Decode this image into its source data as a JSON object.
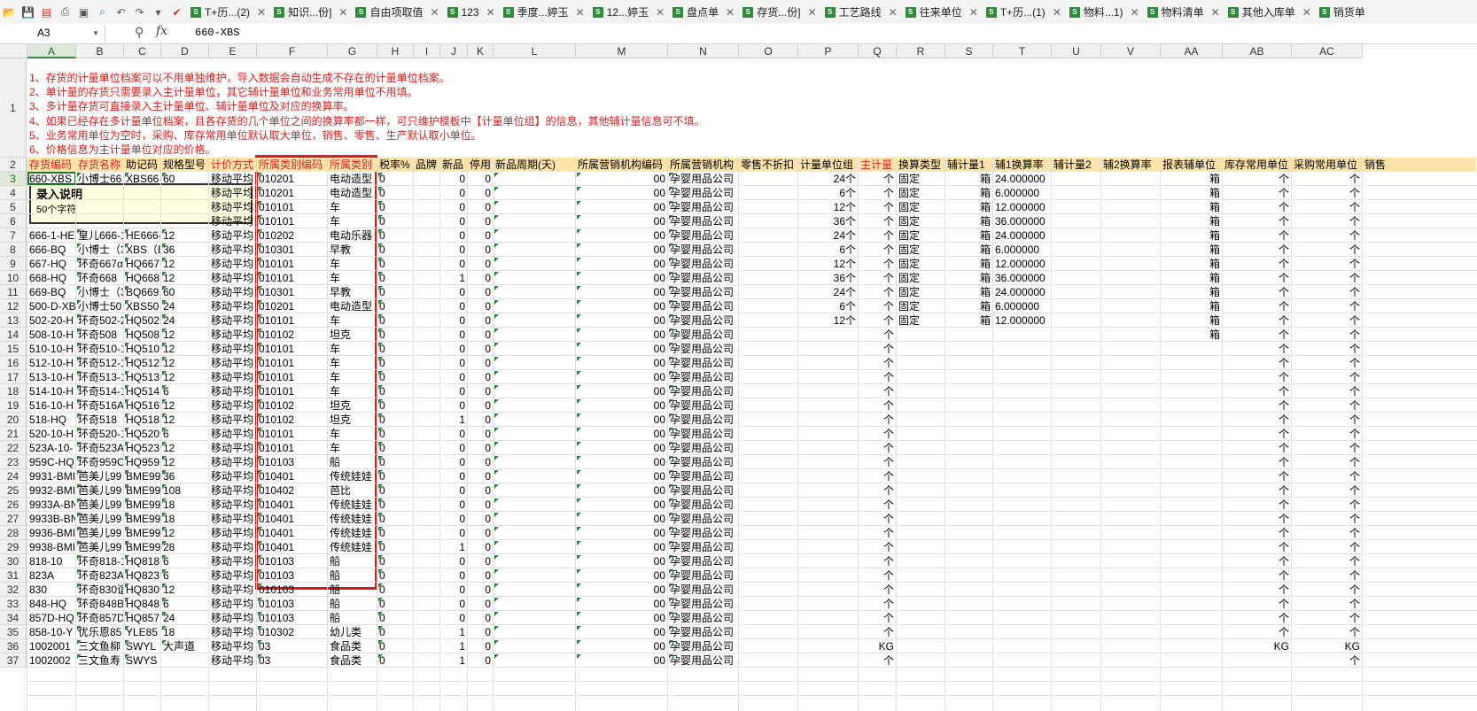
{
  "toolbar": {
    "icons": [
      "open-icon",
      "save-icon",
      "pdf-icon",
      "print-icon",
      "print-preview-icon",
      "find-icon",
      "undo-icon",
      "redo-icon",
      "dropdown-icon",
      "check-icon"
    ],
    "tabs": [
      {
        "label": "T+历...(2)",
        "closable": true
      },
      {
        "label": "知识...份]",
        "closable": true
      },
      {
        "label": "自由项取值",
        "closable": true
      },
      {
        "label": "123",
        "closable": true
      },
      {
        "label": "季度...婷玉",
        "closable": true
      },
      {
        "label": "12...婷玉",
        "closable": true
      },
      {
        "label": "盘点单",
        "closable": true
      },
      {
        "label": "存货...份]",
        "closable": true
      },
      {
        "label": "工艺路线",
        "closable": true
      },
      {
        "label": "往来单位",
        "closable": true
      },
      {
        "label": "T+历...(1)",
        "closable": true
      },
      {
        "label": "物料...1)",
        "closable": true
      },
      {
        "label": "物料清单",
        "closable": true
      },
      {
        "label": "其他入库单",
        "closable": true
      },
      {
        "label": "销货单",
        "closable": false
      }
    ]
  },
  "formula": {
    "cell_ref": "A3",
    "fx": "fx",
    "value": "660-XBS"
  },
  "columns": [
    "A",
    "B",
    "C",
    "D",
    "E",
    "F",
    "G",
    "H",
    "I",
    "J",
    "K",
    "L",
    "M",
    "N",
    "O",
    "P",
    "Q",
    "R",
    "S",
    "T",
    "U",
    "V",
    "AA",
    "AB",
    "AC"
  ],
  "notes": [
    "1、存货的计量单位档案可以不用单独维护，导入数据会自动生成不存在的计量单位档案。",
    "2、单计量的存货只需要录入主计量单位，其它辅计量单位和业务常用单位不用填。",
    "3、多计量存货可直接录入主计量单位、辅计量单位及对应的换算率。",
    "4、如果已经存在多计量单位档案，且各存货的几个单位之间的换算率都一样，可只维护模板中【计量单位组】的信息，其他辅计量信息可不填。",
    "5、业务常用单位为空时，采购、库存常用单位默认取大单位，销售、零售、生产默认取小单位。",
    "6、价格信息为主计量单位对应的价格。"
  ],
  "headers": [
    "存货编码",
    "存货名称",
    "助记码",
    "规格型号",
    "计价方式",
    "所属类别编码",
    "所属类别",
    "税率%",
    "品牌",
    "新品",
    "停用",
    "新品周期(天)",
    "所属营销机构编码",
    "所属营销机构",
    "零售不折扣",
    "计量单位组",
    "主计量",
    "换算类型",
    "辅计量1",
    "辅1换算率",
    "辅计量2",
    "辅2换算率",
    "报表辅单位",
    "库存常用单位",
    "采购常用单位",
    "销售"
  ],
  "comment": {
    "title": "录入说明",
    "body": "50个字符"
  },
  "rows": [
    {
      "n": "3",
      "a": "660-XBS",
      "b": "小博士66",
      "c": "XBS66",
      "d": "60",
      "e": "移动平均",
      "f": "010201",
      "g": "电动造型",
      "h": "0",
      "j": "0",
      "k": "0",
      "m": "00",
      "nn": "孕婴用品公司",
      "p": "24个",
      "q": "个",
      "r": "固定",
      "s": "箱",
      "t": "24.000000",
      "aa": "箱",
      "ab": "个",
      "ac": "个"
    },
    {
      "n": "4",
      "a": "",
      "b": "",
      "c": "",
      "d": "",
      "e": "移动平均",
      "f": "010201",
      "g": "电动造型",
      "h": "0",
      "j": "0",
      "k": "0",
      "m": "00",
      "nn": "孕婴用品公司",
      "p": "6个",
      "q": "个",
      "r": "固定",
      "s": "箱",
      "t": "6.000000",
      "aa": "箱",
      "ab": "个",
      "ac": "个"
    },
    {
      "n": "5",
      "a": "",
      "b": "",
      "c": "",
      "d": "",
      "e": "移动平均",
      "f": "010101",
      "g": "车",
      "h": "0",
      "j": "0",
      "k": "0",
      "m": "00",
      "nn": "孕婴用品公司",
      "p": "12个",
      "q": "个",
      "r": "固定",
      "s": "箱",
      "t": "12.000000",
      "aa": "箱",
      "ab": "个",
      "ac": "个"
    },
    {
      "n": "6",
      "a": "",
      "b": "",
      "c": "",
      "d": "",
      "e": "移动平均",
      "f": "010101",
      "g": "车",
      "h": "0",
      "j": "0",
      "k": "0",
      "m": "00",
      "nn": "孕婴用品公司",
      "p": "36个",
      "q": "个",
      "r": "固定",
      "s": "箱",
      "t": "36.000000",
      "aa": "箱",
      "ab": "个",
      "ac": "个"
    },
    {
      "n": "7",
      "a": "666-1-HE",
      "b": "皇儿666-1",
      "c": "HE666-1",
      "d": "12",
      "e": "移动平均",
      "f": "010202",
      "g": "电动乐器",
      "h": "0",
      "j": "0",
      "k": "0",
      "m": "00",
      "nn": "孕婴用品公司",
      "p": "24个",
      "q": "个",
      "r": "固定",
      "s": "箱",
      "t": "24.000000",
      "aa": "箱",
      "ab": "个",
      "ac": "个"
    },
    {
      "n": "8",
      "a": "666-BQ",
      "b": "小博士（3",
      "c": "XBS（B",
      "d": "36",
      "e": "移动平均",
      "f": "010301",
      "g": "早教",
      "h": "0",
      "j": "0",
      "k": "0",
      "m": "00",
      "nn": "孕婴用品公司",
      "p": "6个",
      "q": "个",
      "r": "固定",
      "s": "箱",
      "t": "6.000000",
      "aa": "箱",
      "ab": "个",
      "ac": "个"
    },
    {
      "n": "9",
      "a": "667-HQ",
      "b": "环奇667α",
      "c": "HQ667",
      "d": "12",
      "e": "移动平均",
      "f": "010101",
      "g": "车",
      "h": "0",
      "j": "0",
      "k": "0",
      "m": "00",
      "nn": "孕婴用品公司",
      "p": "12个",
      "q": "个",
      "r": "固定",
      "s": "箱",
      "t": "12.000000",
      "aa": "箱",
      "ab": "个",
      "ac": "个"
    },
    {
      "n": "10",
      "a": "668-HQ",
      "b": "环奇668",
      "c": "HQ668",
      "d": "12",
      "e": "移动平均",
      "f": "010101",
      "g": "车",
      "h": "0",
      "j": "1",
      "k": "0",
      "m": "00",
      "nn": "孕婴用品公司",
      "p": "36个",
      "q": "个",
      "r": "固定",
      "s": "箱",
      "t": "36.000000",
      "aa": "箱",
      "ab": "个",
      "ac": "个"
    },
    {
      "n": "11",
      "a": "669-BQ",
      "b": "小博士（3",
      "c": "BQ669",
      "d": "60",
      "e": "移动平均",
      "f": "010301",
      "g": "早教",
      "h": "0",
      "j": "0",
      "k": "0",
      "m": "00",
      "nn": "孕婴用品公司",
      "p": "24个",
      "q": "个",
      "r": "固定",
      "s": "箱",
      "t": "24.000000",
      "aa": "箱",
      "ab": "个",
      "ac": "个"
    },
    {
      "n": "12",
      "a": "500-D-XB",
      "b": "小博士50",
      "c": "XBS50",
      "d": "24",
      "e": "移动平均",
      "f": "010201",
      "g": "电动造型",
      "h": "0",
      "j": "0",
      "k": "0",
      "m": "00",
      "nn": "孕婴用品公司",
      "p": "6个",
      "q": "个",
      "r": "固定",
      "s": "箱",
      "t": "6.000000",
      "aa": "箱",
      "ab": "个",
      "ac": "个"
    },
    {
      "n": "13",
      "a": "502-20-H",
      "b": "环奇502-2",
      "c": "HQ502",
      "d": "24",
      "e": "移动平均",
      "f": "010101",
      "g": "车",
      "h": "0",
      "j": "0",
      "k": "0",
      "m": "00",
      "nn": "孕婴用品公司",
      "p": "12个",
      "q": "个",
      "r": "固定",
      "s": "箱",
      "t": "12.000000",
      "aa": "箱",
      "ab": "个",
      "ac": "个"
    },
    {
      "n": "14",
      "a": "508-10-H",
      "b": "环奇508",
      "c": "HQ508",
      "d": "12",
      "e": "移动平均",
      "f": "010102",
      "g": "坦克",
      "h": "0",
      "j": "0",
      "k": "0",
      "m": "00",
      "nn": "孕婴用品公司",
      "p": "",
      "q": "个",
      "r": "",
      "s": "",
      "t": "",
      "aa": "箱",
      "ab": "个",
      "ac": "个"
    },
    {
      "n": "15",
      "a": "510-10-H",
      "b": "环奇510-1",
      "c": "HQ510",
      "d": "12",
      "e": "移动平均",
      "f": "010101",
      "g": "车",
      "h": "0",
      "j": "0",
      "k": "0",
      "m": "00",
      "nn": "孕婴用品公司",
      "p": "",
      "q": "个",
      "r": "",
      "s": "",
      "t": "",
      "aa": "",
      "ab": "个",
      "ac": "个"
    },
    {
      "n": "16",
      "a": "512-10-H",
      "b": "环奇512-1",
      "c": "HQ512",
      "d": "12",
      "e": "移动平均",
      "f": "010101",
      "g": "车",
      "h": "0",
      "j": "0",
      "k": "0",
      "m": "00",
      "nn": "孕婴用品公司",
      "p": "",
      "q": "个",
      "r": "",
      "s": "",
      "t": "",
      "aa": "",
      "ab": "个",
      "ac": "个"
    },
    {
      "n": "17",
      "a": "513-10-H",
      "b": "环奇513-1",
      "c": "HQ513",
      "d": "12",
      "e": "移动平均",
      "f": "010101",
      "g": "车",
      "h": "0",
      "j": "0",
      "k": "0",
      "m": "00",
      "nn": "孕婴用品公司",
      "p": "",
      "q": "个",
      "r": "",
      "s": "",
      "t": "",
      "aa": "",
      "ab": "个",
      "ac": "个"
    },
    {
      "n": "18",
      "a": "514-10-H",
      "b": "环奇514-1",
      "c": "HQ514",
      "d": "6",
      "e": "移动平均",
      "f": "010101",
      "g": "车",
      "h": "0",
      "j": "0",
      "k": "0",
      "m": "00",
      "nn": "孕婴用品公司",
      "p": "",
      "q": "个",
      "r": "",
      "s": "",
      "t": "",
      "aa": "",
      "ab": "个",
      "ac": "个"
    },
    {
      "n": "19",
      "a": "516-10-H",
      "b": "环奇516A",
      "c": "HQ516",
      "d": "12",
      "e": "移动平均",
      "f": "010102",
      "g": "坦克",
      "h": "0",
      "j": "0",
      "k": "0",
      "m": "00",
      "nn": "孕婴用品公司",
      "p": "",
      "q": "个",
      "r": "",
      "s": "",
      "t": "",
      "aa": "",
      "ab": "个",
      "ac": "个"
    },
    {
      "n": "20",
      "a": "518-HQ",
      "b": "环奇518",
      "c": "HQ518",
      "d": "12",
      "e": "移动平均",
      "f": "010102",
      "g": "坦克",
      "h": "0",
      "j": "1",
      "k": "0",
      "m": "00",
      "nn": "孕婴用品公司",
      "p": "",
      "q": "个",
      "r": "",
      "s": "",
      "t": "",
      "aa": "",
      "ab": "个",
      "ac": "个"
    },
    {
      "n": "21",
      "a": "520-10-H",
      "b": "环奇520-1",
      "c": "HQ520",
      "d": "6",
      "e": "移动平均",
      "f": "010101",
      "g": "车",
      "h": "0",
      "j": "0",
      "k": "0",
      "m": "00",
      "nn": "孕婴用品公司",
      "p": "",
      "q": "个",
      "r": "",
      "s": "",
      "t": "",
      "aa": "",
      "ab": "个",
      "ac": "个"
    },
    {
      "n": "22",
      "a": "523A-10-",
      "b": "环奇523A",
      "c": "HQ523",
      "d": "12",
      "e": "移动平均",
      "f": "010101",
      "g": "车",
      "h": "0",
      "j": "0",
      "k": "0",
      "m": "00",
      "nn": "孕婴用品公司",
      "p": "",
      "q": "个",
      "r": "",
      "s": "",
      "t": "",
      "aa": "",
      "ab": "个",
      "ac": "个"
    },
    {
      "n": "23",
      "a": "959C-HQ",
      "b": "环奇959C",
      "c": "HQ959",
      "d": "12",
      "e": "移动平均",
      "f": "010103",
      "g": "船",
      "h": "0",
      "j": "0",
      "k": "0",
      "m": "00",
      "nn": "孕婴用品公司",
      "p": "",
      "q": "个",
      "r": "",
      "s": "",
      "t": "",
      "aa": "",
      "ab": "个",
      "ac": "个"
    },
    {
      "n": "24",
      "a": "9931-BMI",
      "b": "芭美儿99",
      "c": "BME99",
      "d": "36",
      "e": "移动平均",
      "f": "010401",
      "g": "传统娃娃",
      "h": "0",
      "j": "0",
      "k": "0",
      "m": "00",
      "nn": "孕婴用品公司",
      "p": "",
      "q": "个",
      "r": "",
      "s": "",
      "t": "",
      "aa": "",
      "ab": "个",
      "ac": "个"
    },
    {
      "n": "25",
      "a": "9932-BMI",
      "b": "芭美儿99",
      "c": "BME99",
      "d": "108",
      "e": "移动平均",
      "f": "010402",
      "g": "芭比",
      "h": "0",
      "j": "0",
      "k": "0",
      "m": "00",
      "nn": "孕婴用品公司",
      "p": "",
      "q": "个",
      "r": "",
      "s": "",
      "t": "",
      "aa": "",
      "ab": "个",
      "ac": "个"
    },
    {
      "n": "26",
      "a": "9933A-BN",
      "b": "芭美儿99",
      "c": "BME99",
      "d": "18",
      "e": "移动平均",
      "f": "010401",
      "g": "传统娃娃",
      "h": "0",
      "j": "0",
      "k": "0",
      "m": "00",
      "nn": "孕婴用品公司",
      "p": "",
      "q": "个",
      "r": "",
      "s": "",
      "t": "",
      "aa": "",
      "ab": "个",
      "ac": "个"
    },
    {
      "n": "27",
      "a": "9933B-BN",
      "b": "芭美儿99",
      "c": "BME99",
      "d": "18",
      "e": "移动平均",
      "f": "010401",
      "g": "传统娃娃",
      "h": "0",
      "j": "0",
      "k": "0",
      "m": "00",
      "nn": "孕婴用品公司",
      "p": "",
      "q": "个",
      "r": "",
      "s": "",
      "t": "",
      "aa": "",
      "ab": "个",
      "ac": "个"
    },
    {
      "n": "28",
      "a": "9936-BMI",
      "b": "芭美儿99",
      "c": "BME99",
      "d": "12",
      "e": "移动平均",
      "f": "010401",
      "g": "传统娃娃",
      "h": "0",
      "j": "0",
      "k": "0",
      "m": "00",
      "nn": "孕婴用品公司",
      "p": "",
      "q": "个",
      "r": "",
      "s": "",
      "t": "",
      "aa": "",
      "ab": "个",
      "ac": "个"
    },
    {
      "n": "29",
      "a": "9938-BMI",
      "b": "芭美儿99",
      "c": "BME99",
      "d": "28",
      "e": "移动平均",
      "f": "010401",
      "g": "传统娃娃",
      "h": "0",
      "j": "1",
      "k": "0",
      "m": "00",
      "nn": "孕婴用品公司",
      "p": "",
      "q": "个",
      "r": "",
      "s": "",
      "t": "",
      "aa": "",
      "ab": "个",
      "ac": "个"
    },
    {
      "n": "30",
      "a": "818-10",
      "b": "环奇818-1",
      "c": "HQ818",
      "d": "6",
      "e": "移动平均",
      "f": "010103",
      "g": "船",
      "h": "0",
      "j": "0",
      "k": "0",
      "m": "00",
      "nn": "孕婴用品公司",
      "p": "",
      "q": "个",
      "r": "",
      "s": "",
      "t": "",
      "aa": "",
      "ab": "个",
      "ac": "个"
    },
    {
      "n": "31",
      "a": "823A",
      "b": "环奇823A",
      "c": "HQ823",
      "d": "6",
      "e": "移动平均",
      "f": "010103",
      "g": "船",
      "h": "0",
      "j": "0",
      "k": "0",
      "m": "00",
      "nn": "孕婴用品公司",
      "p": "",
      "q": "个",
      "r": "",
      "s": "",
      "t": "",
      "aa": "",
      "ab": "个",
      "ac": "个"
    },
    {
      "n": "32",
      "a": "830",
      "b": "环奇830谊",
      "c": "HQ830",
      "d": "12",
      "e": "移动平均",
      "f": "010103",
      "g": "船",
      "h": "0",
      "j": "0",
      "k": "0",
      "m": "00",
      "nn": "孕婴用品公司",
      "p": "",
      "q": "个",
      "r": "",
      "s": "",
      "t": "",
      "aa": "",
      "ab": "个",
      "ac": "个"
    },
    {
      "n": "33",
      "a": "848-HQ",
      "b": "环奇848B",
      "c": "HQ848",
      "d": "6",
      "e": "移动平均",
      "f": "010103",
      "g": "船",
      "h": "0",
      "j": "0",
      "k": "0",
      "m": "00",
      "nn": "孕婴用品公司",
      "p": "",
      "q": "个",
      "r": "",
      "s": "",
      "t": "",
      "aa": "",
      "ab": "个",
      "ac": "个"
    },
    {
      "n": "34",
      "a": "857D-HQ",
      "b": "环奇857D",
      "c": "HQ857",
      "d": "24",
      "e": "移动平均",
      "f": "010103",
      "g": "船",
      "h": "0",
      "j": "0",
      "k": "0",
      "m": "00",
      "nn": "孕婴用品公司",
      "p": "",
      "q": "个",
      "r": "",
      "s": "",
      "t": "",
      "aa": "",
      "ab": "个",
      "ac": "个"
    },
    {
      "n": "35",
      "a": "858-10-Y",
      "b": "优乐恩85",
      "c": "YLE85",
      "d": "18",
      "e": "移动平均",
      "f": "010302",
      "g": "幼儿类",
      "h": "0",
      "j": "1",
      "k": "0",
      "m": "00",
      "nn": "孕婴用品公司",
      "p": "",
      "q": "个",
      "r": "",
      "s": "",
      "t": "",
      "aa": "",
      "ab": "个",
      "ac": "个"
    },
    {
      "n": "36",
      "a": "1002001",
      "b": "三文鱼柳",
      "c": "SWYL",
      "d": "大声道",
      "e": "移动平均",
      "f": "03",
      "g": "食品类",
      "h": "0",
      "j": "1",
      "k": "0",
      "m": "00",
      "nn": "孕婴用品公司",
      "p": "",
      "q": "KG",
      "r": "",
      "s": "",
      "t": "",
      "aa": "",
      "ab": "KG",
      "ac": "KG"
    },
    {
      "n": "37",
      "a": "1002002",
      "b": "三文鱼寿",
      "c": "SWYS",
      "d": "",
      "e": "移动平均",
      "f": "03",
      "g": "食品类",
      "h": "0",
      "j": "1",
      "k": "0",
      "m": "00",
      "nn": "孕婴用品公司",
      "p": "",
      "q": "个",
      "r": "",
      "s": "",
      "t": "",
      "aa": "",
      "ab": "",
      "ac": "个"
    }
  ]
}
